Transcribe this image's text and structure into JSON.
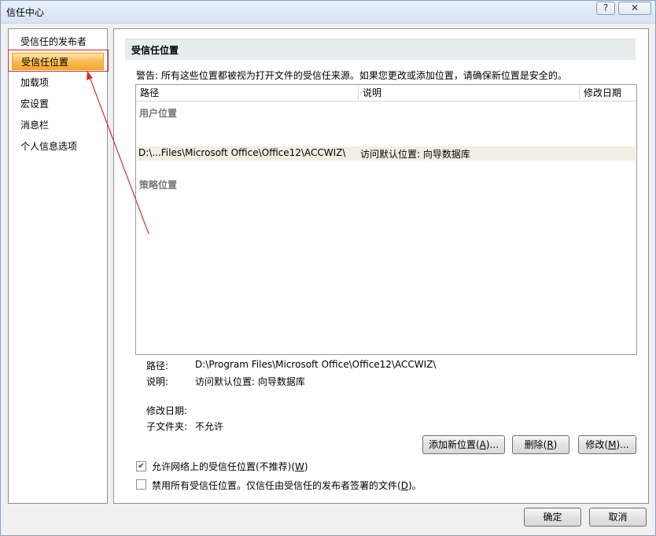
{
  "window": {
    "title": "信任中心",
    "help_glyph": "?",
    "close_glyph": "✕"
  },
  "nav": {
    "items": [
      {
        "label": "受信任的发布者"
      },
      {
        "label": "受信任位置"
      },
      {
        "label": "加载项"
      },
      {
        "label": "宏设置"
      },
      {
        "label": "消息栏"
      },
      {
        "label": "个人信息选项"
      }
    ],
    "selected_index": 1
  },
  "section": {
    "title": "受信任位置",
    "warning": "警告: 所有这些位置都被视为打开文件的受信任来源。如果您更改或添加位置，请确保新位置是安全的。"
  },
  "table": {
    "columns": [
      "路径",
      "说明",
      "修改日期"
    ],
    "group_user": "用户位置",
    "group_policy": "策略位置",
    "rows": [
      {
        "path": "D:\\...Files\\Microsoft Office\\Office12\\ACCWIZ\\",
        "description": "访问默认位置: 向导数据库",
        "modified": ""
      }
    ]
  },
  "details": {
    "path_label": "路径:",
    "path_value": "D:\\Program Files\\Microsoft Office\\Office12\\ACCWIZ\\",
    "desc_label": "说明:",
    "desc_value": "访问默认位置: 向导数据库",
    "modified_label": "修改日期:",
    "modified_value": "",
    "subfolder_label": "子文件夹:",
    "subfolder_value": "不允许"
  },
  "buttons": {
    "add_text": "添加新位置(",
    "add_key": "A",
    "add_tail": ")...",
    "delete_text": "删除(",
    "delete_key": "R",
    "delete_tail": ")",
    "modify_text": "修改(",
    "modify_key": "M",
    "modify_tail": ")...",
    "ok": "确定",
    "cancel": "取消"
  },
  "options": {
    "network_text": "允许网络上的受信任位置(不推荐)(",
    "network_key": "W",
    "network_tail": ")",
    "network_checked": true,
    "disable_text": "禁用所有受信任位置。仅信任由受信任的发布者签署的文件(",
    "disable_key": "D",
    "disable_tail": ")。",
    "disable_checked": false
  }
}
